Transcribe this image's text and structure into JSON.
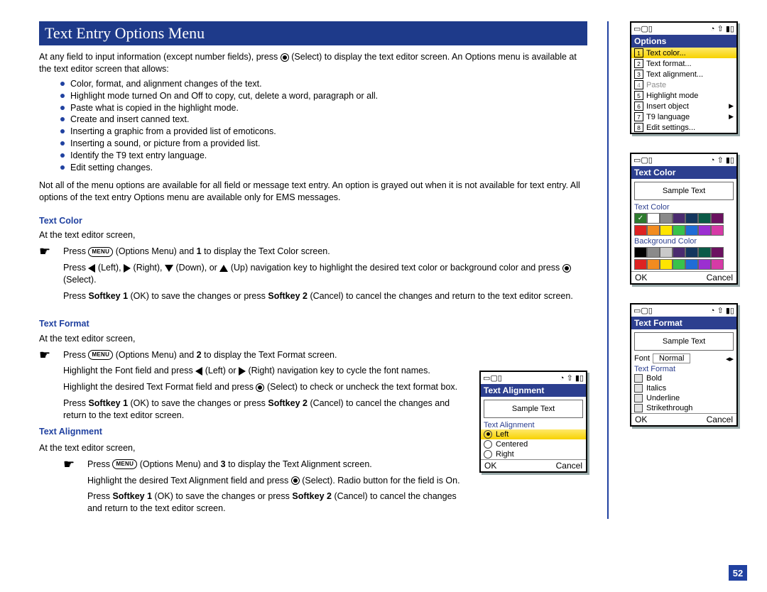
{
  "title": "Text Entry Options Menu",
  "intro1": "At any field to input information (except number fields), press",
  "intro2": "(Select) to display the text editor screen. An Options menu is available at the text editor screen that allows:",
  "intro_bullets": [
    "Color, format, and alignment changes of the text.",
    "Highlight mode turned On and Off to copy, cut, delete a word, paragraph or all.",
    "Paste what is copied in the highlight mode.",
    "Create and insert canned text.",
    "Inserting a graphic from a provided list of emoticons.",
    "Inserting a sound, or picture from a provided list.",
    "Identify the T9 text entry language.",
    "Edit setting changes."
  ],
  "intro_after": "Not all of the menu options are available for all field or message text entry.  An option is grayed out when it is not available for text entry. All options of the text entry Options menu are available only for EMS messages.",
  "tc": {
    "head": "Text Color",
    "lead": "At the text editor screen,",
    "step1a": "Press",
    "step1b": "(Options Menu) and",
    "step1num": "1",
    "step1c": "to display the Text Color screen.",
    "step2a": "Press",
    "step2b": "(Left),",
    "step2c": "(Right),",
    "step2d": "(Down), or",
    "step2e": "(Up) navigation key to highlight the desired text color or background color and press",
    "step2f": "(Select).",
    "step3a": "Press",
    "sk1": "Softkey 1",
    "step3b": "(OK) to save the changes or press",
    "sk2": "Softkey 2",
    "step3c": "(Cancel) to cancel the changes and return to the text editor screen."
  },
  "tf": {
    "head": "Text Format",
    "lead": "At the text editor screen,",
    "s1a": "Press",
    "s1b": "(Options Menu) and",
    "s1n": "2",
    "s1c": "to display the Text Format screen.",
    "s2a": "Highlight the Font field and press",
    "s2b": "(Left) or",
    "s2c": "(Right) navigation key to cycle the font names.",
    "s3a": "Highlight the desired Text Format field and press",
    "s3b": "(Select) to check or uncheck the text format box.",
    "s4a": "Press",
    "s4b": "(OK) to save the changes or press",
    "s4c": "(Cancel) to cancel the changes and return to the text editor screen."
  },
  "ta": {
    "head": "Text Alignment",
    "lead": "At the text editor screen,",
    "s1a": "Press",
    "s1b": "(Options Menu) and",
    "s1n": "3",
    "s1c": "to display the Text Alignment screen.",
    "s2a": "Highlight the desired Text Alignment field and press",
    "s2b": "(Select). Radio button for the field is On.",
    "s3a": "Press",
    "s3b": "(OK) to save the changes or press",
    "s3c": "(Cancel) to cancel the changes and return to the text editor screen."
  },
  "menu_label": "MENU",
  "options_screen": {
    "title": "Options",
    "items": [
      {
        "n": "1",
        "label": "Text color...",
        "hl": true
      },
      {
        "n": "2",
        "label": "Text format..."
      },
      {
        "n": "3",
        "label": "Text alignment..."
      },
      {
        "n": "4",
        "label": "Paste",
        "disabled": true
      },
      {
        "n": "5",
        "label": "Highlight mode"
      },
      {
        "n": "6",
        "label": "Insert object",
        "sub": true
      },
      {
        "n": "7",
        "label": "T9 language",
        "sub": true
      },
      {
        "n": "8",
        "label": "Edit settings..."
      }
    ]
  },
  "textcolor_screen": {
    "title": "Text Color",
    "sample": "Sample Text",
    "label1": "Text Color",
    "label2": "Background Color",
    "ok": "OK",
    "cancel": "Cancel"
  },
  "textalign_screen": {
    "title": "Text Alignment",
    "sample": "Sample Text",
    "label": "Text Alignment",
    "items": [
      "Left",
      "Centered",
      "Right"
    ],
    "ok": "OK",
    "cancel": "Cancel"
  },
  "textformat_screen": {
    "title": "Text Format",
    "sample": "Sample Text",
    "font_label": "Font",
    "font_value": "Normal",
    "group": "Text Format",
    "items": [
      "Bold",
      "Italics",
      "Underline",
      "Strikethrough"
    ],
    "ok": "OK",
    "cancel": "Cancel"
  },
  "page_number": "52"
}
